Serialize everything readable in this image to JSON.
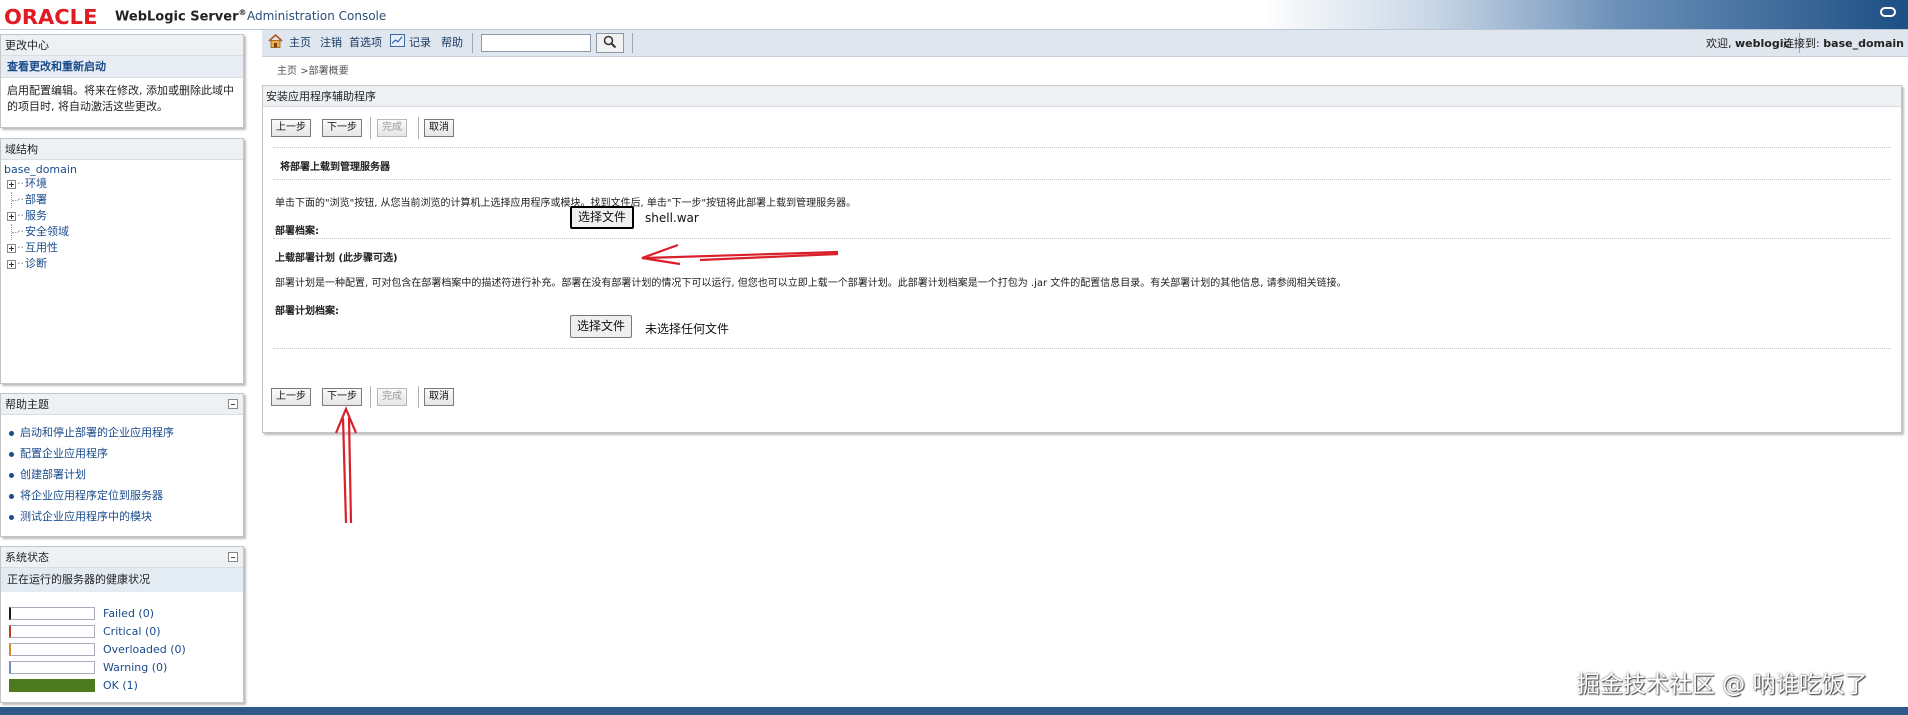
{
  "header": {
    "logo": "ORACLE",
    "product": "WebLogic Server",
    "product_mark": "®",
    "subtitle": "Administration Console"
  },
  "change_center": {
    "title": "更改中心",
    "link": "查看更改和重新启动",
    "description": "启用配置编辑。将来在修改, 添加或删除此域中的项目时, 将自动激活这些更改。"
  },
  "domain_structure": {
    "title": "域结构",
    "root": "base_domain",
    "items": [
      {
        "label": "环境",
        "expandable": true
      },
      {
        "label": "部署",
        "expandable": false
      },
      {
        "label": "服务",
        "expandable": true
      },
      {
        "label": "安全领域",
        "expandable": false
      },
      {
        "label": "互用性",
        "expandable": true
      },
      {
        "label": "诊断",
        "expandable": true
      }
    ]
  },
  "help_topics": {
    "title": "帮助主题",
    "items": [
      "启动和停止部署的企业应用程序",
      "配置企业应用程序",
      "创建部署计划",
      "将企业应用程序定位到服务器",
      "测试企业应用程序中的模块"
    ]
  },
  "system_status": {
    "title": "系统状态",
    "health_label": "正在运行的服务器的健康状况",
    "rows": [
      {
        "label": "Failed (0)",
        "color": "#1a1a1a",
        "fill": 0
      },
      {
        "label": "Critical (0)",
        "color": "#c0392b",
        "fill": 0
      },
      {
        "label": "Overloaded (0)",
        "color": "#d68a2e",
        "fill": 0
      },
      {
        "label": "Warning (0)",
        "color": "#6b8fb5",
        "fill": 0
      },
      {
        "label": "OK (1)",
        "color": "#4d7a1e",
        "fill": 1
      }
    ]
  },
  "navbar": {
    "home": "主页",
    "logout": "注销",
    "preferences": "首选项",
    "record": "记录",
    "help": "帮助",
    "search_value": "",
    "welcome_prefix": "欢迎, ",
    "welcome_user": "weblogic",
    "connected_prefix": "连接到: ",
    "connected_domain": "base_domain"
  },
  "breadcrumb": {
    "home": "主页",
    "separator": ">",
    "current": "部署概要"
  },
  "wizard": {
    "title": "安装应用程序辅助程序",
    "buttons": {
      "back": "上一步",
      "next": "下一步",
      "finish": "完成",
      "cancel": "取消"
    },
    "section_title": "将部署上载到管理服务器",
    "instruction": "单击下面的\"浏览\"按钮, 从您当前浏览的计算机上选择应用程序或模块。找到文件后, 单击\"下一步\"按钮将此部署上载到管理服务器。",
    "archive_label": "部署档案:",
    "choose_file": "选择文件",
    "archive_file": "shell.war",
    "plan_title": "上载部署计划 (此步骤可选)",
    "plan_desc": "部署计划是一种配置, 可对包含在部署档案中的描述符进行补充。部署在没有部署计划的情况下可以运行, 但您也可以立即上载一个部署计划。此部署计划档案是一个打包为 .jar 文件的配置信息目录。有关部署计划的其他信息, 请参阅相关链接。",
    "plan_label": "部署计划档案:",
    "plan_file": "未选择任何文件"
  },
  "watermark": "掘金技术社区 @ 呐谁吃饭了",
  "colors": {
    "link": "#1a4b8c",
    "oracle_red": "#e11b22",
    "annotation_red": "#d9202a"
  }
}
